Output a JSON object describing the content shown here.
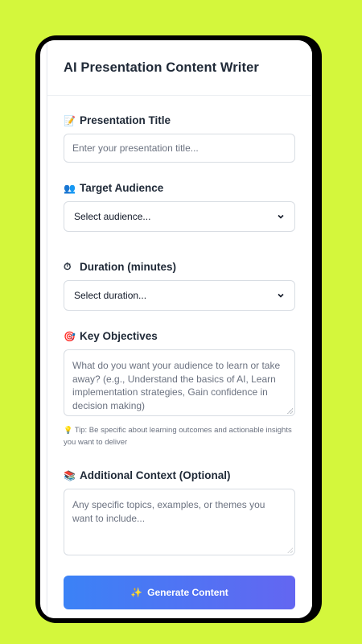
{
  "app": {
    "title": "AI Presentation Content Writer"
  },
  "form": {
    "title_field": {
      "icon": "memo-icon",
      "label": "Presentation Title",
      "placeholder": "Enter your presentation title..."
    },
    "audience_field": {
      "icon": "people-icon",
      "label": "Target Audience",
      "value": "Select audience..."
    },
    "duration_field": {
      "icon": "stopwatch-icon",
      "label": "Duration (minutes)",
      "value": "Select duration..."
    },
    "objectives_field": {
      "icon": "target-icon",
      "label": "Key Objectives",
      "placeholder": "What do you want your audience to learn or take away? (e.g., Understand the basics of AI, Learn implementation strategies, Gain confidence in decision making)"
    },
    "tip": {
      "icon": "lightbulb-icon",
      "text": "Tip: Be specific about learning outcomes and actionable insights you want to deliver"
    },
    "context_field": {
      "icon": "books-icon",
      "label": "Additional Context (Optional)",
      "placeholder": "Any specific topics, examples, or themes you want to include..."
    },
    "submit": {
      "icon": "sparkles-icon",
      "label": "Generate Content"
    }
  },
  "colors": {
    "background": "#d4f73c",
    "button_start": "#3b82f6",
    "button_end": "#6366f1"
  }
}
